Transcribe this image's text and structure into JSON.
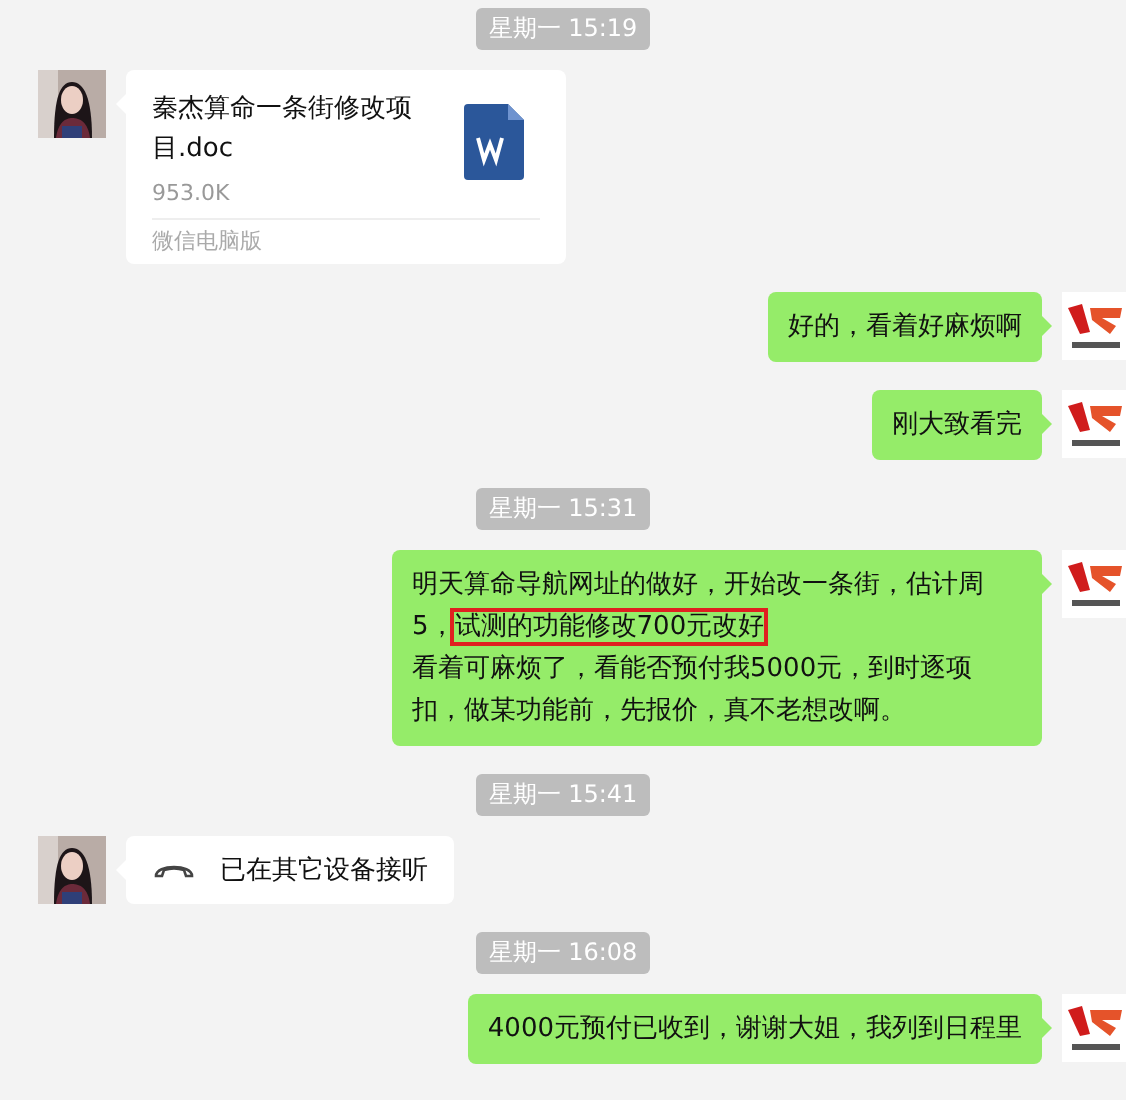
{
  "messages": [
    {
      "kind": "time",
      "text": "星期一 15:19"
    },
    {
      "kind": "file",
      "outgoing": false,
      "name": "秦杰算命一条街修改项目.doc",
      "size": "953.0K",
      "source": "微信电脑版"
    },
    {
      "kind": "text",
      "outgoing": true,
      "parts": [
        {
          "text": "好的，看着好麻烦啊",
          "highlighted": false
        }
      ]
    },
    {
      "kind": "text",
      "outgoing": true,
      "parts": [
        {
          "text": "刚大致看完",
          "highlighted": false
        }
      ]
    },
    {
      "kind": "time",
      "text": "星期一 15:31"
    },
    {
      "kind": "text",
      "outgoing": true,
      "parts": [
        {
          "text": "明天算命导航网址的做好，开始改一条街，估计周5，",
          "highlighted": false
        },
        {
          "text": "试测的功能修改700元改好",
          "highlighted": true
        },
        {
          "text": "\n看着可麻烦了，看能否预付我5000元，到时逐项扣，做某功能前，先报价，真不老想改啊。",
          "highlighted": false
        }
      ]
    },
    {
      "kind": "time",
      "text": "星期一 15:41"
    },
    {
      "kind": "call",
      "outgoing": false,
      "text": "已在其它设备接听"
    },
    {
      "kind": "time",
      "text": "星期一 16:08"
    },
    {
      "kind": "text",
      "outgoing": true,
      "parts": [
        {
          "text": "4000元预付已收到，谢谢大姐，我列到日程里",
          "highlighted": false
        }
      ]
    }
  ]
}
